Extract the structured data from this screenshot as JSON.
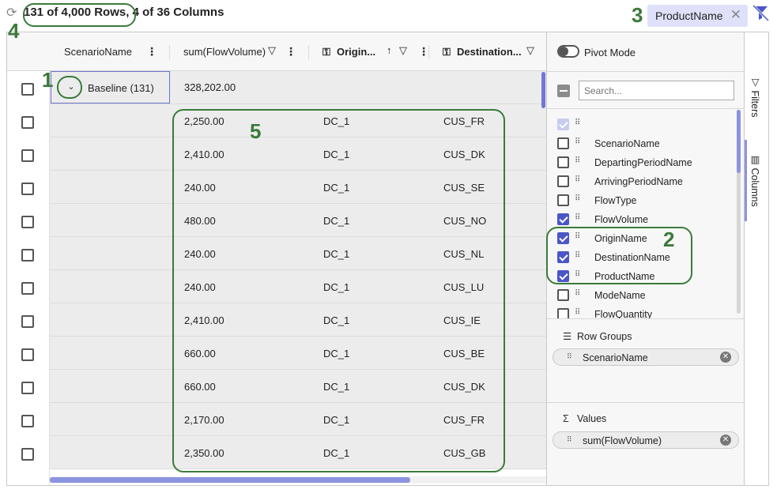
{
  "toolbar": {
    "refresh_icon": "refresh-icon",
    "row_count": "131 of 4,000 Rows, 4 of 36 Columns",
    "active_filter_chip": "ProductName",
    "chip_close": "✕",
    "clear_filter_icon": "filter-clear-icon"
  },
  "grid": {
    "columns": [
      {
        "label": "ScenarioName"
      },
      {
        "label": "sum(FlowVolume)"
      },
      {
        "label": "Origin..."
      },
      {
        "label": "Destination..."
      }
    ],
    "group_row": {
      "label": "Baseline (131)",
      "sum": "328,202.00"
    },
    "rows": [
      {
        "volume": "2,250.00",
        "origin": "DC_1",
        "destination": "CUS_FR"
      },
      {
        "volume": "2,410.00",
        "origin": "DC_1",
        "destination": "CUS_DK"
      },
      {
        "volume": "240.00",
        "origin": "DC_1",
        "destination": "CUS_SE"
      },
      {
        "volume": "480.00",
        "origin": "DC_1",
        "destination": "CUS_NO"
      },
      {
        "volume": "240.00",
        "origin": "DC_1",
        "destination": "CUS_NL"
      },
      {
        "volume": "240.00",
        "origin": "DC_1",
        "destination": "CUS_LU"
      },
      {
        "volume": "2,410.00",
        "origin": "DC_1",
        "destination": "CUS_IE"
      },
      {
        "volume": "660.00",
        "origin": "DC_1",
        "destination": "CUS_BE"
      },
      {
        "volume": "660.00",
        "origin": "DC_1",
        "destination": "CUS_DK"
      },
      {
        "volume": "2,170.00",
        "origin": "DC_1",
        "destination": "CUS_FR"
      },
      {
        "volume": "2,350.00",
        "origin": "DC_1",
        "destination": "CUS_GB"
      }
    ]
  },
  "panel": {
    "pivot_mode_label": "Pivot Mode",
    "search_placeholder": "Search...",
    "columns": [
      {
        "name": "",
        "checked": "dim"
      },
      {
        "name": "ScenarioName",
        "checked": "off"
      },
      {
        "name": "DepartingPeriodName",
        "checked": "off"
      },
      {
        "name": "ArrivingPeriodName",
        "checked": "off"
      },
      {
        "name": "FlowType",
        "checked": "off"
      },
      {
        "name": "FlowVolume",
        "checked": "on"
      },
      {
        "name": "OriginName",
        "checked": "on"
      },
      {
        "name": "DestinationName",
        "checked": "on"
      },
      {
        "name": "ProductName",
        "checked": "on"
      },
      {
        "name": "ModeName",
        "checked": "off"
      },
      {
        "name": "FlowQuantity",
        "checked": "off"
      }
    ],
    "row_groups_label": "Row Groups",
    "row_group_pill": "ScenarioName",
    "values_label": "Values",
    "values_pill": "sum(FlowVolume)"
  },
  "side_tabs": {
    "filters": "Filters",
    "columns": "Columns"
  },
  "callouts": {
    "c1": "1",
    "c2": "2",
    "c3": "3",
    "c4": "4",
    "c5": "5"
  },
  "colors": {
    "accent": "#4b56c9",
    "chip_bg": "#dfe1fb",
    "callout_green": "#3b7a3b"
  }
}
